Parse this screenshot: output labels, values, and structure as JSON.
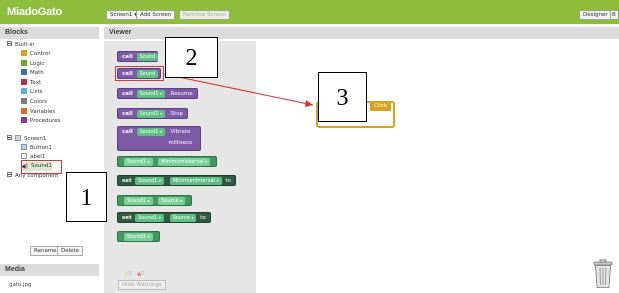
{
  "app": {
    "brand": "MiadoGato"
  },
  "toolbar": {
    "screen_selector": "Screen1 ▾",
    "add_screen": "Add Screen",
    "remove_screen": "Remove Screen",
    "designer": "Designer",
    "blocks_partial": "B"
  },
  "blocks_panel": {
    "title": "Blocks",
    "builtin_label": "Built-in",
    "categories": [
      {
        "label": "Control",
        "color": "#d9a21b"
      },
      {
        "label": "Logic",
        "color": "#6aa834"
      },
      {
        "label": "Math",
        "color": "#3f6fb4"
      },
      {
        "label": "Text",
        "color": "#b4324d"
      },
      {
        "label": "Lists",
        "color": "#64a9e0"
      },
      {
        "label": "Colors",
        "color": "#7c7c7c"
      },
      {
        "label": "Variables",
        "color": "#d96b29"
      },
      {
        "label": "Procedures",
        "color": "#7d3f9a"
      }
    ],
    "screen_label": "Screen1",
    "components": [
      "Button1",
      "abel1",
      "Sound1"
    ],
    "any_component": "Any component",
    "rename_button": "Rename",
    "delete_button": "Delete"
  },
  "media_panel": {
    "title": "Media",
    "items": [
      "gato.jpg"
    ]
  },
  "viewer": {
    "title": "Viewer",
    "warnings_count": "0",
    "errors_count": "0",
    "hide_warnings": "Hide Warnings"
  },
  "blocks": {
    "call": "call",
    "set": "set",
    "to": "to",
    "component": "Sound1",
    "component_trunc": "Sound",
    "resume": ".Resume",
    "stop": ".Stop",
    "vibrate": ".Vibrate",
    "millisecs": "millisecs",
    "minimum_interval": "MinimumInterval",
    "source": "Source",
    "dropped_block": "Click"
  },
  "annotations": {
    "one": "1",
    "two": "2",
    "three": "3"
  },
  "colors": {
    "topbar": "#8ebd3d",
    "panel_header": "#dcdcdc",
    "highlight_red": "#d23a3a",
    "block_purple": "#7c5aa6",
    "block_teal": "#43985f",
    "block_dark_green": "#2d5a41",
    "event_gold": "#d9a21b"
  },
  "icons": [
    "trash-icon",
    "warning-icon",
    "error-icon",
    "speaker-icon",
    "label-icon",
    "button-icon",
    "screen-icon"
  ]
}
